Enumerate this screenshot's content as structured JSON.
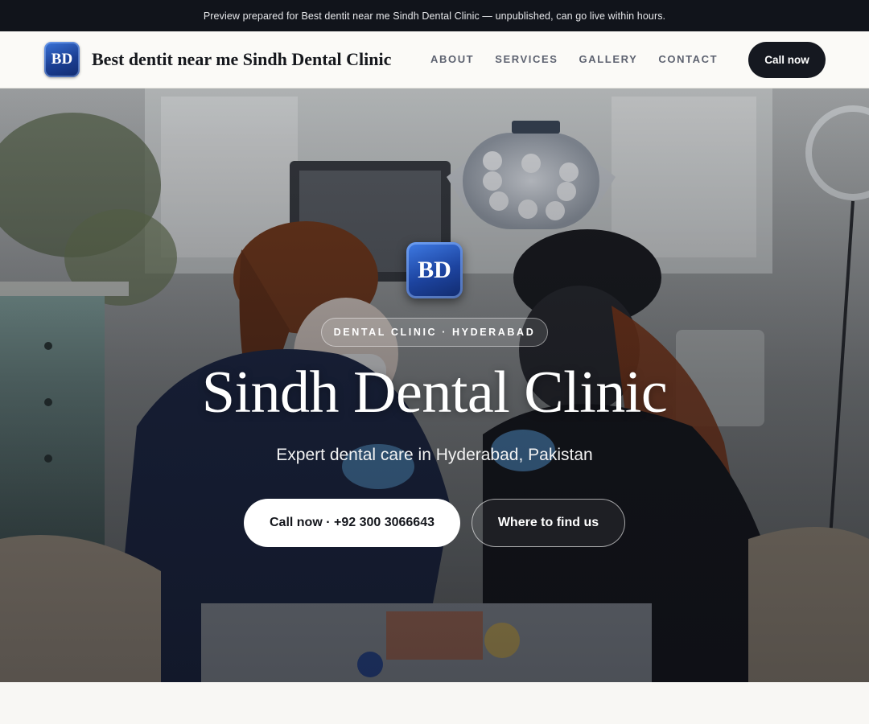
{
  "preview_banner": "Preview prepared for Best dentit near me Sindh Dental Clinic — unpublished, can go live within hours.",
  "header": {
    "logo_text": "BD",
    "brand_name": "Best dentit near me Sindh Dental Clinic",
    "nav": [
      "ABOUT",
      "SERVICES",
      "GALLERY",
      "CONTACT"
    ],
    "cta_label": "Call now"
  },
  "hero": {
    "logo_text": "BD",
    "badge": "DENTAL CLINIC · HYDERABAD",
    "title": "Sindh Dental Clinic",
    "subtitle": "Expert dental care in Hyderabad, Pakistan",
    "primary_button": "Call now · +92 300 3066643",
    "secondary_button": "Where to find us"
  },
  "colors": {
    "topbar_bg": "#11141b",
    "cta_bg": "#151820",
    "logo_blue": "#1d44a0"
  }
}
